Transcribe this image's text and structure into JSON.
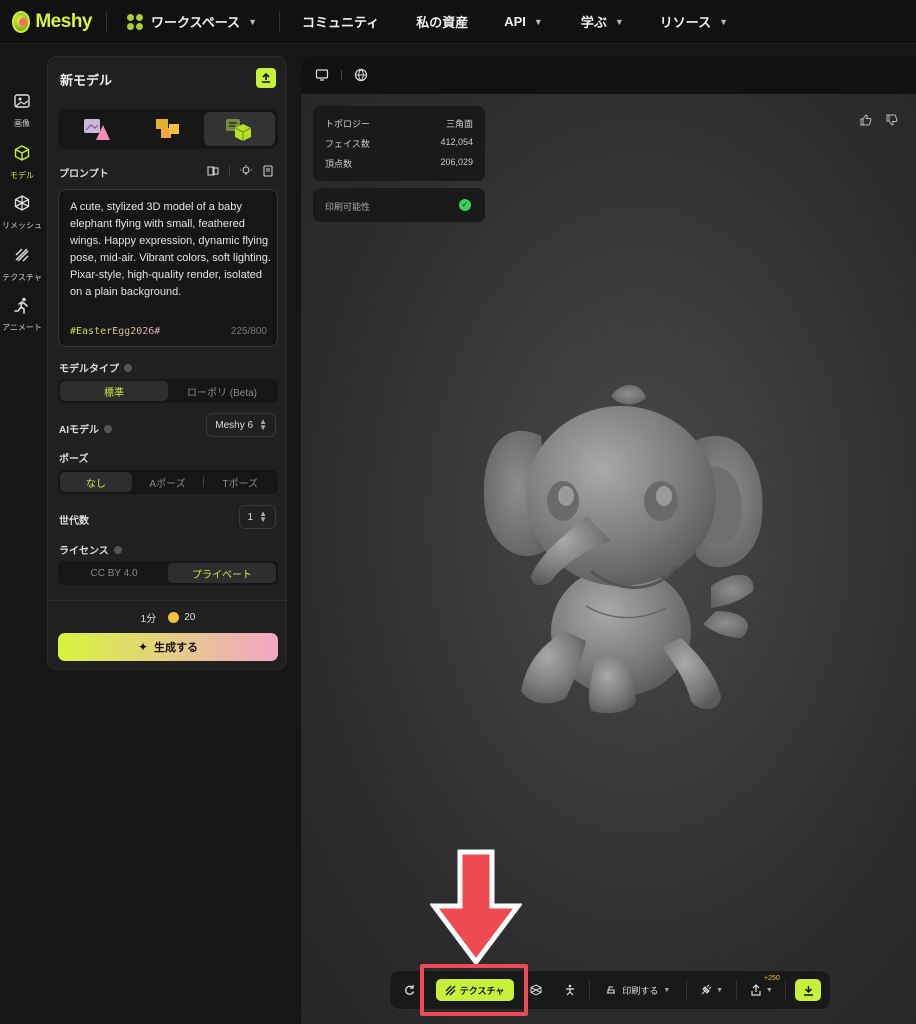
{
  "app": {
    "logo_text": "Meshy"
  },
  "nav": {
    "workspace": "ワークスペース",
    "community": "コミュニティ",
    "assets": "私の資産",
    "api": "API",
    "learn": "学ぶ",
    "resources": "リソース"
  },
  "rail": [
    {
      "label": "画像",
      "icon": "image-icon"
    },
    {
      "label": "モデル",
      "icon": "cube-icon"
    },
    {
      "label": "リメッシュ",
      "icon": "remesh-icon"
    },
    {
      "label": "テクスチャ",
      "icon": "texture-icon"
    },
    {
      "label": "アニメート",
      "icon": "running-figure-icon"
    }
  ],
  "panel": {
    "title": "新モデル",
    "prompt_label": "プロンプト",
    "prompt_text": "A cute, stylized 3D model of a baby elephant flying with small, feathered wings. Happy expression, dynamic flying pose, mid-air. Vibrant colors, soft lighting. Pixar-style, high-quality render, isolated on a plain background.",
    "hashtag": "#EasterEgg2026#",
    "char_count": "225/800",
    "model_type_label": "モデルタイプ",
    "model_type_options": [
      "標準",
      "ローポリ (Beta)"
    ],
    "ai_model_label": "AIモデル",
    "ai_model_value": "Meshy 6",
    "pose_label": "ポーズ",
    "pose_options": [
      "なし",
      "Aポーズ",
      "Tポーズ"
    ],
    "generations_label": "世代数",
    "generations_value": "1",
    "license_label": "ライセンス",
    "license_options": [
      "CC BY 4.0",
      "プライベート"
    ],
    "time": "1分",
    "credits": "20",
    "generate_label": "生成する"
  },
  "viewport": {
    "stats": [
      {
        "label": "トポロジー",
        "value": "三角面"
      },
      {
        "label": "フェイス数",
        "value": "412,054"
      },
      {
        "label": "頂点数",
        "value": "206,029"
      }
    ],
    "printable_label": "印刷可能性"
  },
  "toolbar": {
    "texture_label": "テクスチャ",
    "print_label": "印刷する",
    "credit_badge": "+250"
  },
  "colors": {
    "accent": "#c8ef3a",
    "annotation": "#ef4a52"
  }
}
